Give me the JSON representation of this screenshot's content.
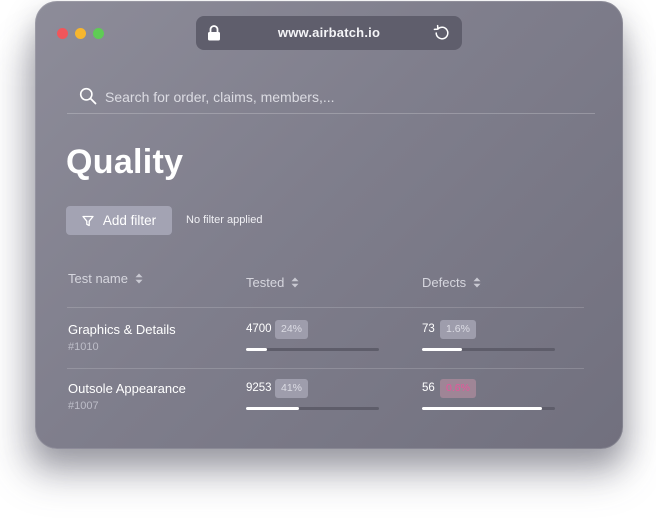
{
  "browser": {
    "url": "www.airbatch.io"
  },
  "search": {
    "placeholder": "Search for order, claims, members,..."
  },
  "page": {
    "title": "Quality"
  },
  "filter": {
    "button_label": "Add filter",
    "status": "No filter applied"
  },
  "table": {
    "columns": [
      "Test name",
      "Tested",
      "Defects"
    ],
    "rows": [
      {
        "name": "Graphics & Details",
        "id": "#1010",
        "tested": "4700",
        "tested_pct": "24%",
        "tested_fill": 0.16,
        "defects": "73",
        "defects_pct": "1.6%",
        "defects_fill": 0.3,
        "defects_alert": false
      },
      {
        "name": "Outsole Appearance",
        "id": "#1007",
        "tested": "9253",
        "tested_pct": "41%",
        "tested_fill": 0.4,
        "defects": "56",
        "defects_pct": "0.6%",
        "defects_fill": 0.9,
        "defects_alert": true
      }
    ]
  },
  "colors": {
    "alert_text": "#e6569b",
    "window_bg": "#807f8d",
    "button_bg": "#a3a3b3"
  },
  "icons": [
    "lock-icon",
    "reload-icon",
    "search-icon",
    "funnel-icon",
    "sort-icon"
  ]
}
